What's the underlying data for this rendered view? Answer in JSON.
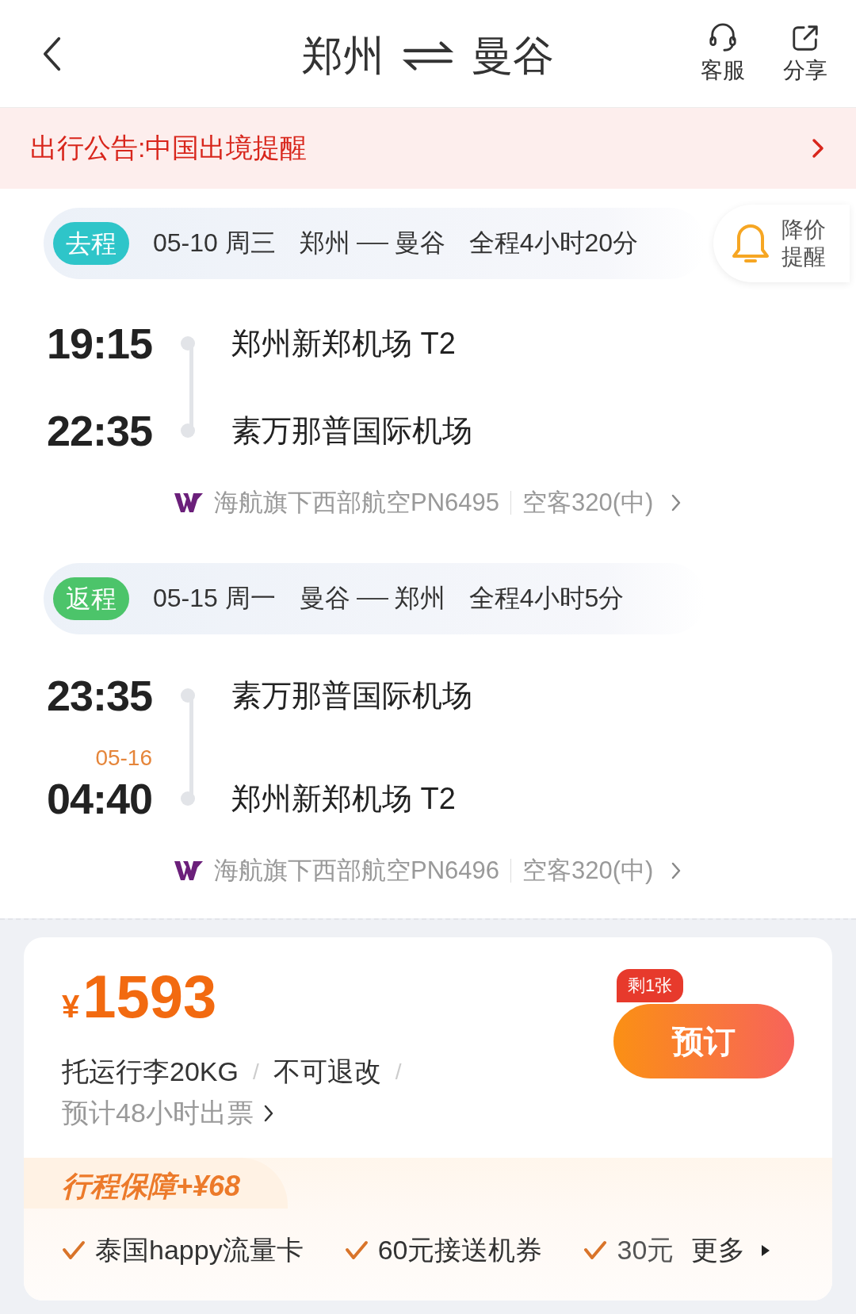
{
  "header": {
    "from": "郑州",
    "to": "曼谷",
    "actions": [
      {
        "kind": "service",
        "label": "客服"
      },
      {
        "kind": "share",
        "label": "分享"
      }
    ]
  },
  "notice": {
    "text": "出行公告:中国出境提醒"
  },
  "price_alert": {
    "label": "降价提醒"
  },
  "segments": [
    {
      "badge": "去程",
      "color": "#2ec5c9",
      "date": "05-10 周三",
      "from": "郑州",
      "to": "曼谷",
      "duration": "全程4小时20分",
      "stops": [
        {
          "time": "19:15",
          "airport": "郑州新郑机场 T2"
        },
        {
          "time": "22:35",
          "airport": "素万那普国际机场"
        }
      ],
      "flight": "海航旗下西部航空PN6495",
      "aircraft": "空客320(中)"
    },
    {
      "badge": "返程",
      "color": "#4cc46a",
      "date": "05-15 周一",
      "from": "曼谷",
      "to": "郑州",
      "duration": "全程4小时5分",
      "stops": [
        {
          "time": "23:35",
          "airport": "素万那普国际机场"
        },
        {
          "date": "05-16",
          "time": "04:40",
          "airport": "郑州新郑机场 T2"
        }
      ],
      "flight": "海航旗下西部航空PN6496",
      "aircraft": "空客320(中)"
    }
  ],
  "offer": {
    "badge": "剩1张",
    "currency": "¥",
    "price": "1593",
    "book": "预订",
    "rules": [
      "托运行李20KG",
      "不可退改"
    ],
    "separator": "/",
    "ticketing": "预计48小时出票",
    "protection": {
      "title": "行程保障+¥68",
      "perks": [
        "泰国happy流量卡",
        "60元接送机券",
        "30元"
      ],
      "more": "更多"
    }
  }
}
